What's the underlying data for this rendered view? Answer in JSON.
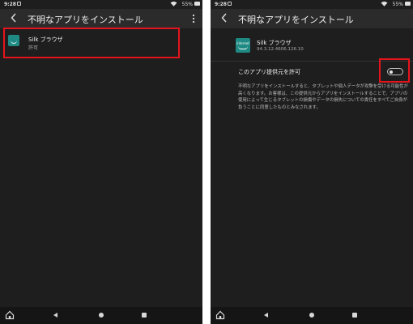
{
  "status_bar": {
    "time": "9:28",
    "battery": "55%"
  },
  "left_screen": {
    "title": "不明なアプリをインストール",
    "app": {
      "name": "Silk ブラウザ",
      "status": "許可"
    }
  },
  "right_screen": {
    "title": "不明なアプリをインストール",
    "app": {
      "name": "Silk ブラウザ",
      "version": "94.3.12.4606.126.10",
      "icon_word": "internet"
    },
    "toggle_label": "このアプリ提供元を許可",
    "toggle_state": "off",
    "description": "不明なアプリをインストールすると、タブレットや個人データが攻撃を受ける可能性が高くなります。お客様は、この提供元からアプリをインストールすることで、アプリの使用によって生じるタブレットの損傷やデータの損失についての責任をすべてご自身が負うことに同意したものとみなされます。"
  },
  "colors": {
    "background": "#1e1e1e",
    "app_bar": "#2b2b2b",
    "highlight": "#e5141c",
    "app_icon": "#1f8a83"
  },
  "icons": [
    "back-arrow-icon",
    "overflow-menu-icon",
    "wifi-icon",
    "battery-icon",
    "notification-icon",
    "home-icon",
    "nav-back-icon",
    "nav-home-icon",
    "nav-recents-icon"
  ]
}
